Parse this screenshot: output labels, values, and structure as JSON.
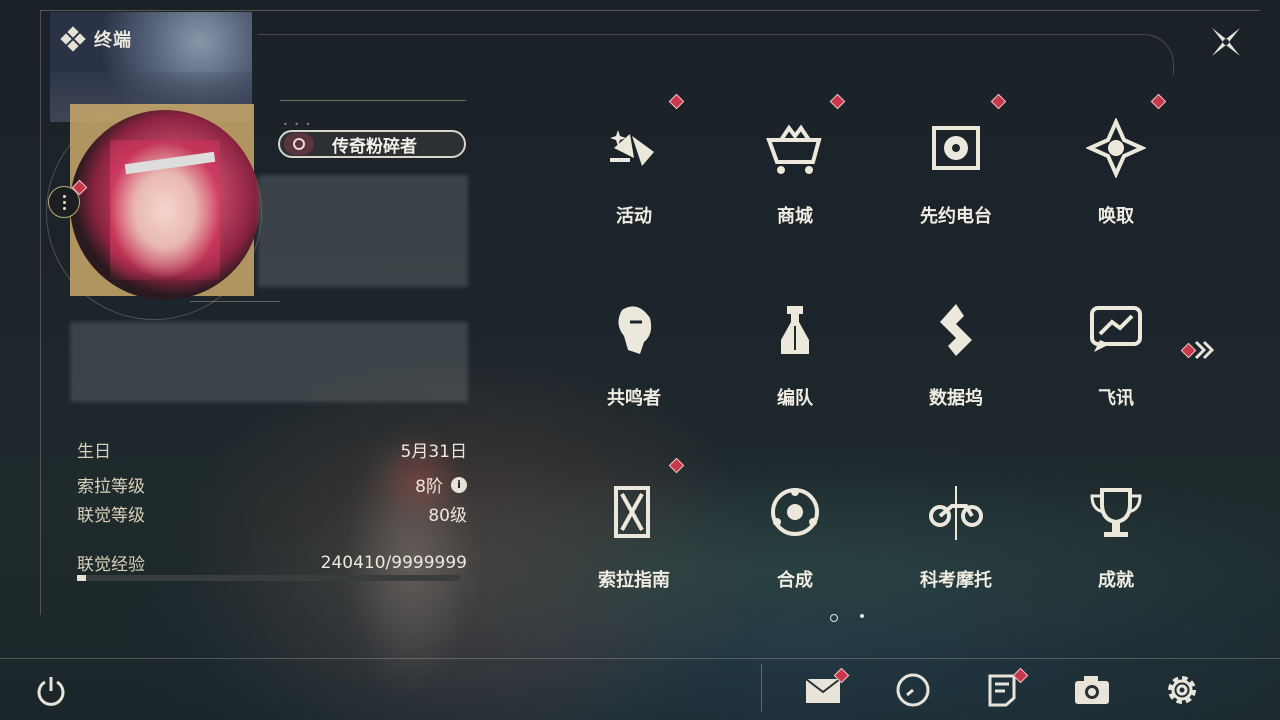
{
  "header": {
    "title": "终端"
  },
  "profile": {
    "title_badge": "传奇粉碎者",
    "birthday_label": "生日",
    "birthday_value": "5月31日",
    "sola_level_label": "索拉等级",
    "sola_level_value": "8阶",
    "union_level_label": "联觉等级",
    "union_level_value": "80级",
    "exp_label": "联觉经验",
    "exp_value": "240410/9999999",
    "exp_progress": 0.024
  },
  "menu": {
    "items": [
      {
        "label": "活动",
        "icon": "event-icon",
        "badge": true
      },
      {
        "label": "商城",
        "icon": "shop-icon",
        "badge": true
      },
      {
        "label": "先约电台",
        "icon": "radio-icon",
        "badge": true
      },
      {
        "label": "唤取",
        "icon": "convene-icon",
        "badge": true
      },
      {
        "label": "共鸣者",
        "icon": "resonator-icon",
        "badge": false
      },
      {
        "label": "编队",
        "icon": "team-icon",
        "badge": false
      },
      {
        "label": "数据坞",
        "icon": "databank-icon",
        "badge": false
      },
      {
        "label": "飞讯",
        "icon": "message-icon",
        "badge": false
      },
      {
        "label": "索拉指南",
        "icon": "guidebook-icon",
        "badge": true
      },
      {
        "label": "合成",
        "icon": "synthesis-icon",
        "badge": false
      },
      {
        "label": "科考摩托",
        "icon": "motorcycle-icon",
        "badge": false
      },
      {
        "label": "成就",
        "icon": "trophy-icon",
        "badge": false
      }
    ],
    "page_count": 2,
    "current_page": 1
  },
  "bottom_bar": [
    "power-icon",
    "mail-icon",
    "clock-icon",
    "notice-icon",
    "camera-icon",
    "settings-icon"
  ],
  "colors": {
    "accent_gold": "#c9b98c",
    "badge_red": "#c8384d",
    "text": "#f0ece2"
  }
}
